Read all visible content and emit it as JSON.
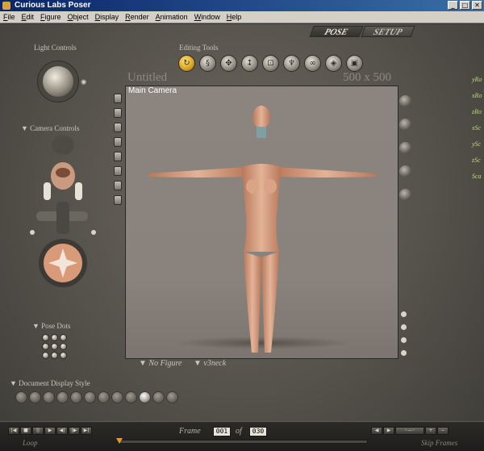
{
  "window": {
    "title": "Curious Labs Poser",
    "min_glyph": "_",
    "max_glyph": "□",
    "close_glyph": "✕"
  },
  "menu": [
    "File",
    "Edit",
    "Figure",
    "Object",
    "Display",
    "Render",
    "Animation",
    "Window",
    "Help"
  ],
  "rooms": {
    "pose": "POSE",
    "setup": "SETUP"
  },
  "panels": {
    "light_controls": "Light Controls",
    "editing_tools": "Editing Tools",
    "camera_controls": "Camera Controls",
    "pose_dots": "Pose Dots",
    "document_display_style": "Document Display Style"
  },
  "document": {
    "title": "Untitled",
    "size": "500 x 500",
    "camera": "Main Camera"
  },
  "figure_selector": {
    "figure": "No Figure",
    "part": "v3neck"
  },
  "parameters": [
    "yRo",
    "xRo",
    "zRo",
    "xSc",
    "ySc",
    "zSc",
    "Sca"
  ],
  "animation": {
    "frame_label": "Frame",
    "current_frame": "001",
    "of_label": "of",
    "total_frames": "030",
    "loop_label": "Loop",
    "skip_frames_label": "Skip Frames",
    "playhead_fraction": 0.0
  },
  "icons": {
    "sun": "sun-icon",
    "rotate": "rotate-tool-icon",
    "twist": "twist-tool-icon",
    "translate": "translate-tool-icon",
    "translate_z": "translate-in-out-tool-icon",
    "scale": "scale-tool-icon",
    "taper": "taper-tool-icon",
    "chain_break": "chain-break-tool-icon",
    "color": "color-tool-icon",
    "view_magnifier": "view-magnifier-tool-icon"
  },
  "colors": {
    "accent": "#d8a020",
    "param_text": "#b9dc7a",
    "viewport_bg": "#8a837d"
  }
}
